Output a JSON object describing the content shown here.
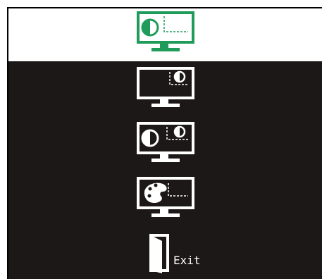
{
  "colors": {
    "menu_background": "#1b1817",
    "header_background": "#ffffff",
    "selected_icon": "#1f9c5a",
    "icon": "#ffffff"
  },
  "menu": {
    "items": [
      {
        "id": "contrast-pip",
        "icon": "monitor-contrast-icon",
        "selected": true
      },
      {
        "id": "pip-contrast",
        "icon": "monitor-pip-contrast-icon",
        "selected": false
      },
      {
        "id": "dual-contrast",
        "icon": "monitor-dual-contrast-icon",
        "selected": false
      },
      {
        "id": "color",
        "icon": "monitor-palette-icon",
        "selected": false
      },
      {
        "id": "exit",
        "icon": "exit-door-icon",
        "label": "Exit",
        "selected": false
      }
    ]
  }
}
